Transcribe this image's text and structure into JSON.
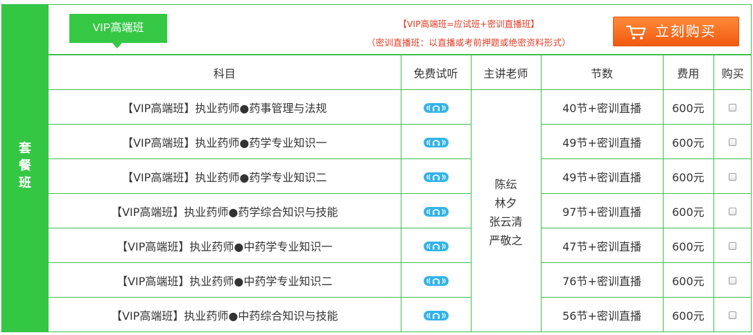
{
  "sidebar": {
    "label_chars": [
      "套",
      "餐",
      "班"
    ]
  },
  "header": {
    "tag": "VIP高端班",
    "note_line1": "【VIP高端班=应试班+密训直播班】",
    "note_line2": "（密训直播班：以直播或考前押题或绝密资料形式）",
    "buy_button": "立刻购买",
    "buy_icon": "shopping-cart-icon"
  },
  "columns": {
    "subject": "科目",
    "trial": "免费试听",
    "teacher": "主讲老师",
    "lessons": "节数",
    "fee": "费用",
    "buy": "购买"
  },
  "teachers": [
    "陈纭",
    "林夕",
    "张云清",
    "严敬之"
  ],
  "rows": [
    {
      "subject": "【VIP高端班】执业药师●药事管理与法规",
      "lessons": "40节+密训直播",
      "fee": "600元"
    },
    {
      "subject": "【VIP高端班】执业药师●药学专业知识一",
      "lessons": "49节+密训直播",
      "fee": "600元"
    },
    {
      "subject": "【VIP高端班】执业药师●药学专业知识二",
      "lessons": "49节+密训直播",
      "fee": "600元"
    },
    {
      "subject": "【VIP高端班】执业药师●药学综合知识与技能",
      "lessons": "97节+密训直播",
      "fee": "600元"
    },
    {
      "subject": "【VIP高端班】执业药师●中药学专业知识一",
      "lessons": "47节+密训直播",
      "fee": "600元"
    },
    {
      "subject": "【VIP高端班】执业药师●中药学专业知识二",
      "lessons": "76节+密训直播",
      "fee": "600元"
    },
    {
      "subject": "【VIP高端班】执业药师●中药综合知识与技能",
      "lessons": "56节+密训直播",
      "fee": "600元"
    }
  ],
  "colors": {
    "green": "#34c744",
    "border": "#3dbd4a",
    "orange": "#f26b1d",
    "red": "#e23a22",
    "audio": "#33b3e8"
  }
}
